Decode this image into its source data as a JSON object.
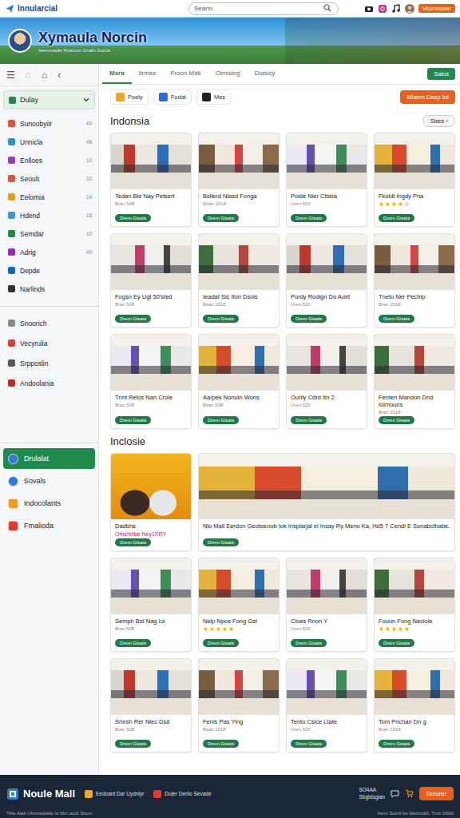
{
  "header": {
    "logo": "Innularcial",
    "search": {
      "placeholder": "Searin"
    },
    "user": "Veuronaner"
  },
  "banner": {
    "title": "Xymaula Norcin",
    "subtitle": "Ieemmaide Rnarosn Onaln Dorcis"
  },
  "sidebar": {
    "toolbar": [
      "☰",
      "◌",
      "⌂",
      "‹"
    ],
    "dropdown": {
      "label": "Dulay",
      "expanded": false
    },
    "items": [
      {
        "label": "Sunoobyiir",
        "count": "49",
        "color": "#e94e3d"
      },
      {
        "label": "Unnicla",
        "count": "48",
        "color": "#2196c9"
      },
      {
        "label": "Enlloes",
        "count": "10",
        "color": "#8e44ad"
      },
      {
        "label": "Seoult",
        "count": "10",
        "color": "#e74c3c"
      },
      {
        "label": "Eelomia",
        "count": "14",
        "color": "#e0a020"
      },
      {
        "label": "Hdend",
        "count": "18",
        "color": "#3498db"
      },
      {
        "label": "Semdar",
        "count": "10",
        "color": "#1e8e3e"
      },
      {
        "label": "Adrig",
        "count": "40",
        "color": "#9c27b0"
      },
      {
        "label": "Depde",
        "color": "#1565c0"
      },
      {
        "label": "Narlinds",
        "color": "#333333"
      }
    ],
    "items2": [
      {
        "label": "Snoorich",
        "color": "#888888"
      },
      {
        "label": "Vecyrulia",
        "color": "#e53935"
      },
      {
        "label": "Srpposlin",
        "color": "#555555"
      },
      {
        "label": "Andoolania",
        "color": "#c62828"
      }
    ],
    "nav": [
      {
        "label": "Drulalat",
        "selected": true,
        "color": "#2b7bd6"
      },
      {
        "label": "Sovals",
        "selected": false,
        "color": "#2b7bd6"
      },
      {
        "label": "Indocolants",
        "selected": false,
        "color": "#f39c12"
      },
      {
        "label": "Fmalioda",
        "selected": false,
        "color": "#e53935"
      }
    ]
  },
  "main": {
    "tabs": [
      {
        "label": "Msra",
        "selected": true
      },
      {
        "label": "Ilrmes",
        "selected": false
      },
      {
        "label": "Froon Mdk",
        "selected": false
      },
      {
        "label": "Olmising",
        "selected": false
      },
      {
        "label": "Diaslcy",
        "selected": false
      }
    ],
    "tab_button": "Salos",
    "chips": [
      {
        "label": "Poely",
        "color": "#f5a623"
      },
      {
        "label": "Fodat",
        "color": "#2b6fd6"
      },
      {
        "label": "Mes",
        "color": "#222222"
      }
    ],
    "promo_button": "Mlamn Dasp bd",
    "sections": [
      {
        "title": "Indonsia",
        "more": "Stare ›",
        "cards": [
          {
            "title": "Tedan Ble Nay Petsert",
            "sub": "Bran 508",
            "button": "Drem Gisats"
          },
          {
            "title": "Bsllerd Nlasd Fonga",
            "sub": "Ehan 2018",
            "button": "Drem Gisats"
          },
          {
            "title": "Polde Nler Clbsia",
            "sub": "Uren 520",
            "button": "Drem Gisats"
          },
          {
            "title": "Fkoldt Ingdy Pna",
            "stars": 4,
            "button": "Drem Gisats"
          },
          {
            "title": "Fogsn Ey Ugt 50'sted",
            "sub": "Bran 508",
            "button": "Drem Gisats"
          },
          {
            "title": "Ieadat Sic Ifon Dsols",
            "sub": "Bsan 2018",
            "button": "Drem Gisats"
          },
          {
            "title": "Purdy Rodign Do Auirt",
            "sub": "Uren 520",
            "button": "Drem Gisats"
          },
          {
            "title": "Tnetu Ner Pechip",
            "sub": "Bran 2018",
            "button": "Drem Gisats"
          },
          {
            "title": "Tnnt Relos Nan Crole",
            "sub": "Bran 508",
            "button": "Drem Gisats"
          },
          {
            "title": "Aarpek Nonuln Wons",
            "sub": "Bsan 508",
            "button": "Drem Gisats"
          },
          {
            "title": "Ourlly Cdrd Itn 2",
            "sub": "Uren 520",
            "button": "Drem Gisats"
          },
          {
            "title": "Fenten Mandon Dnd Iolmouns",
            "sub": "Bran 2018",
            "button": "Drem Gisats"
          }
        ]
      },
      {
        "title": "Inclosie",
        "featured": [
          {
            "title": "Dadbhe",
            "sub": "Omehiilbe Ney1XRY",
            "button": "Drem Gisats"
          },
          {
            "title": "Nlo Mall Eerdon Geoteenob Iok Insplarjal el Insay Ry Meno Ka, Hd5 7 Cendl E Sonabcthabe.",
            "button": "Drem Gisats"
          }
        ],
        "cards": [
          {
            "title": "Semph Bst Nag Ioi",
            "sub": "Bran 508",
            "button": "Drem Gisats"
          },
          {
            "title": "Nelp Npos Fong Gst",
            "stars": 5,
            "button": "Drem Gisats"
          },
          {
            "title": "Cloes Rnon Y",
            "sub": "Uren 520",
            "button": "Drem Gisats"
          },
          {
            "title": "Fouun Fong Neclole",
            "stars": 5,
            "button": "Drem Gisats"
          },
          {
            "title": "Smrsh Rer Nlec Dsd",
            "sub": "Bran 508",
            "button": "Drem Gisats"
          },
          {
            "title": "Fenls Pas Ylng",
            "sub": "Bsan 2018",
            "button": "Drem Gisats"
          },
          {
            "title": "Tento Cslce Ltate",
            "sub": "Uren 520",
            "button": "Drem Gisats"
          },
          {
            "title": "Tom Pnchan Dn g",
            "sub": "Bran 2018",
            "button": "Drem Gisats"
          }
        ]
      }
    ]
  },
  "footer": {
    "logo": "Noule Mall",
    "links": [
      {
        "label": "Eedoant Dar Uydnlyr",
        "color": "#f5a623"
      },
      {
        "label": "Duler Denlo Sevade",
        "color": "#e53935"
      }
    ],
    "info": [
      "SO4AA",
      "Sbgtdsgian"
    ],
    "button": "Sreurer",
    "notice": "Tlhe Aiatl Ulmmedistlu is hbn act& Stocn",
    "credit": "Venn Soinit be Idennubli, Tmit O600"
  }
}
